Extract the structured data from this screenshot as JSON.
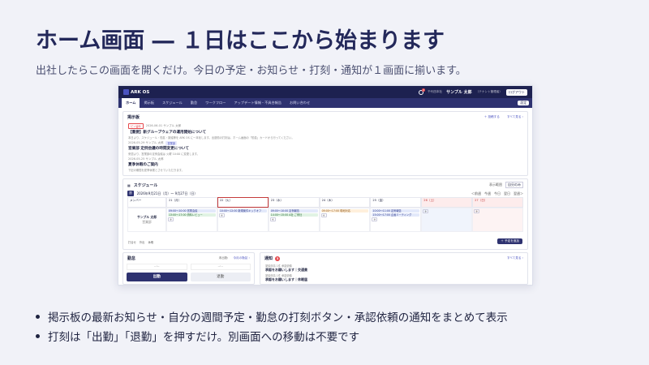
{
  "slide": {
    "title": "ホーム画面 ― １日はここから始まります",
    "subtitle": "出社したらこの画面を開くだけ。今日の予定・お知らせ・打刻・通知が１画面に揃います。",
    "bullets": [
      "掲示板の最新お知らせ・自分の週間予定・勤怠の打刻ボタン・承認依頼の通知をまとめて表示",
      "打刻は「出勤」「退勤」を押すだけ。別画面への移動は不要です"
    ]
  },
  "app": {
    "logo": "ARK OS",
    "notif_count": "3",
    "company": "千代田本社",
    "user": "サンプル 太郎",
    "role": "（テナント管理者）",
    "logout": "ログアウト",
    "nav": [
      "ホーム",
      "掲示板",
      "スケジュール",
      "勤怠",
      "ワークフロー",
      "アップデート情報・不具合報告",
      "お問い合わせ"
    ],
    "settings": "設定",
    "board": {
      "title": "掲示板",
      "post_link": "＋ 投稿する",
      "all_link": "すべて見る ›",
      "posts": [
        {
          "tag": "ピン留め",
          "meta": "2026-06-01 サンプル 太郎",
          "title": "【重要】新グループウェアの運用開始について",
          "body": "本日より、スケジュール・勤怠・稟議等を ARK OS に一本化します。出退勤の打刻は、ホーム画面の「勤怠」カードから行ってください。"
        },
        {
          "tag": "営業部",
          "meta": "2026-05-29 サンプル 太郎",
          "title": "営業部 定例会議の時間変更について",
          "body": "来週より、営業部の定例会議は 火曜 10:00 に変更します。"
        },
        {
          "tag": "",
          "meta": "2026-05-25 サンプル 太郎",
          "title": "夏季休暇のご案内",
          "body": "下記の期間を夏季休業とさせていただきます。"
        }
      ]
    },
    "schedule": {
      "title": "スケジュール",
      "week_label": "週",
      "range": "2026年9月21日（月）～ 9月27日（日）",
      "filter_label": "表示範囲",
      "filter_value": "自分のみ",
      "nav": [
        "＜前週",
        "今週",
        "今日",
        "翌日",
        "翌週＞"
      ],
      "member_header": "メンバー",
      "user": "サンプル 太郎",
      "user_sub": "営業部",
      "days": [
        "21（月）",
        "22（火）",
        "23（水）",
        "24（木）",
        "25（金）",
        "26（土）",
        "27（日）"
      ],
      "events": [
        [
          {
            "c": "blue",
            "t": "09:00〜10:00 営業会議"
          },
          {
            "c": "green",
            "t": "13:00〜17:00 資料レビュー"
          }
        ],
        [
          {
            "c": "blue",
            "t": "10:00〜12:00 新規案件キックオフ"
          }
        ],
        [
          {
            "c": "blue",
            "t": "09:00〜10:00 定例報告"
          },
          {
            "c": "green",
            "t": "14:00〜15:00 A社 ご来社"
          }
        ],
        [
          {
            "c": "orange",
            "t": "09:00〜17:00 現地対応"
          }
        ],
        [
          {
            "c": "blue",
            "t": "10:00〜11:00 定例報告"
          },
          {
            "c": "blue",
            "t": "15:00〜17:00 企画ミーティング"
          }
        ],
        [],
        []
      ],
      "legend": [
        "打合せ",
        "外出",
        "休暇"
      ],
      "add": "＋ 予定を追加"
    },
    "attendance": {
      "title": "勤怠",
      "status": "未出勤",
      "link": "今月の勤怠 ›",
      "in_label": "出勤",
      "out_label": "退勤",
      "in_time": "--:--",
      "out_time": "--:--"
    },
    "notices": {
      "title": "通知",
      "count": "3",
      "link": "すべて見る ›",
      "items": [
        {
          "meta": "稟議申請 1件 承認依頼",
          "text": "承認をお願いします｜交通費"
        },
        {
          "meta": "稟議申請 1件 承認依頼",
          "text": "承認をお願いします｜休暇届"
        }
      ]
    }
  }
}
